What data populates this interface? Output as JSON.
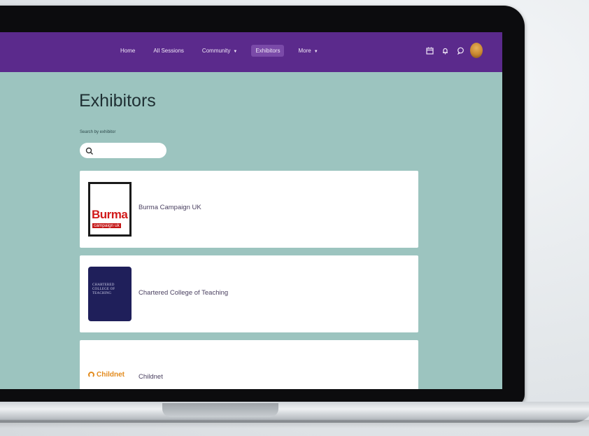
{
  "navbar": {
    "links": [
      {
        "label": "Home",
        "dropdown": false,
        "active": false
      },
      {
        "label": "All Sessions",
        "dropdown": false,
        "active": false
      },
      {
        "label": "Community",
        "dropdown": true,
        "active": false
      },
      {
        "label": "Exhibitors",
        "dropdown": false,
        "active": true
      },
      {
        "label": "More",
        "dropdown": true,
        "active": false
      }
    ],
    "icons": [
      "calendar-icon",
      "bell-icon",
      "chat-icon"
    ],
    "bg_color": "#5b2a8c"
  },
  "main": {
    "title": "Exhibitors",
    "search": {
      "label": "Search by exhibitor",
      "placeholder": "",
      "value": ""
    },
    "exhibitors": [
      {
        "name": "Burma Campaign UK",
        "logo_text": "Burma",
        "logo_subtext": "campaign uk"
      },
      {
        "name": "Chartered College of Teaching",
        "logo_text": "CHARTERED COLLEGE OF TEACHING"
      },
      {
        "name": "Childnet",
        "logo_text": "Childnet"
      }
    ]
  }
}
